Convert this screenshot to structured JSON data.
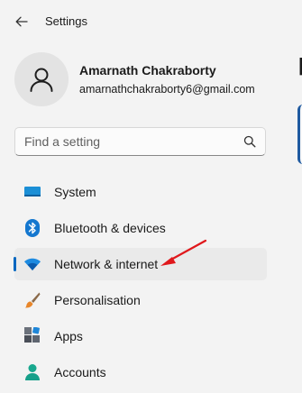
{
  "window": {
    "title": "Settings"
  },
  "profile": {
    "name": "Amarnath Chakraborty",
    "email": "amarnathchakraborty6@gmail.com"
  },
  "search": {
    "placeholder": "Find a setting",
    "value": ""
  },
  "nav": {
    "items": [
      {
        "label": "System",
        "icon": "system-display-icon",
        "selected": false
      },
      {
        "label": "Bluetooth & devices",
        "icon": "bluetooth-icon",
        "selected": false
      },
      {
        "label": "Network & internet",
        "icon": "wifi-icon",
        "selected": true
      },
      {
        "label": "Personalisation",
        "icon": "paintbrush-icon",
        "selected": false
      },
      {
        "label": "Apps",
        "icon": "apps-icon",
        "selected": false
      },
      {
        "label": "Accounts",
        "icon": "account-icon",
        "selected": false
      }
    ]
  },
  "colors": {
    "accent": "#0067c0",
    "background": "#f3f3f3",
    "selected_background": "#eaeaea",
    "annotation_arrow": "#e0181c"
  }
}
